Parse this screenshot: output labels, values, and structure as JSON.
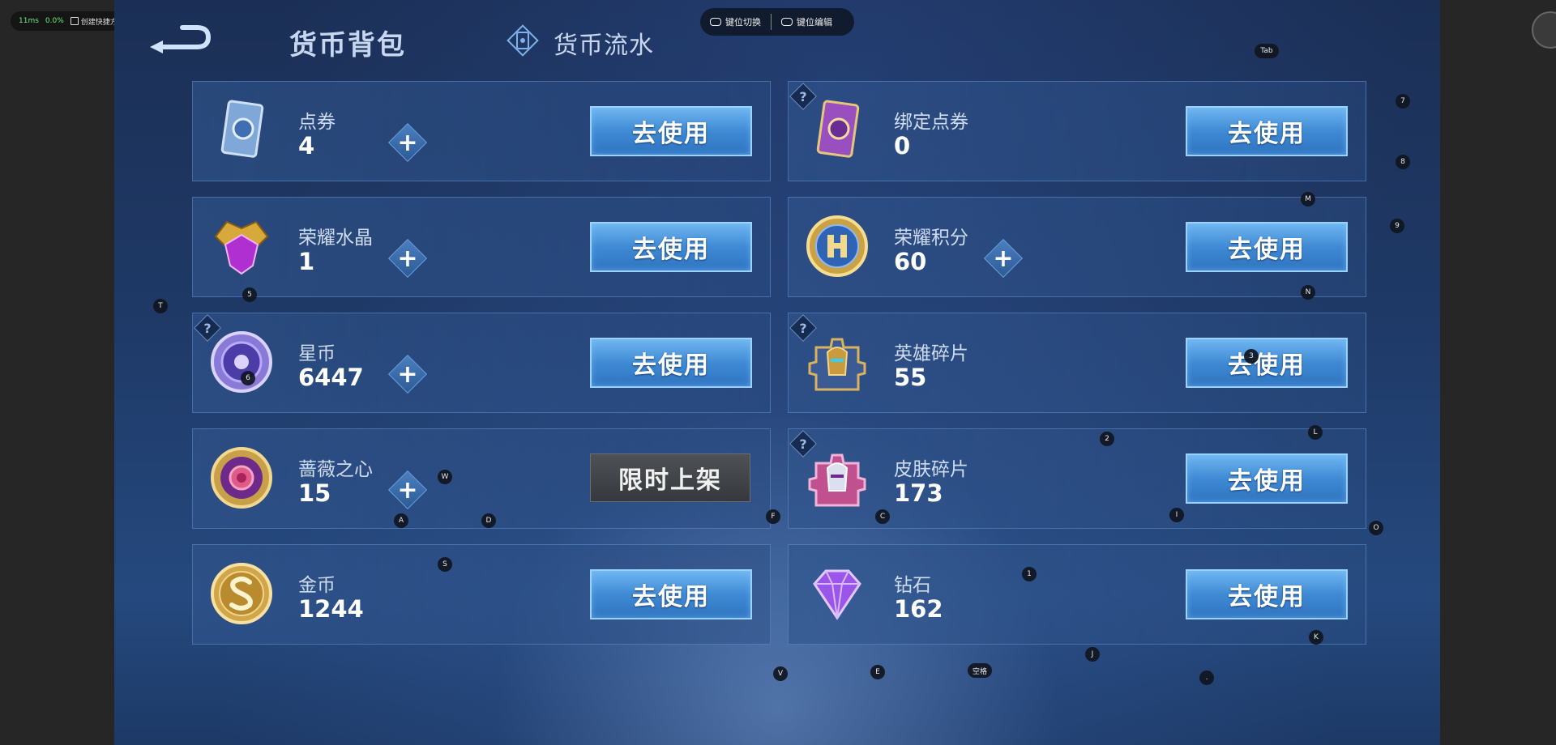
{
  "overlay": {
    "latency": "11ms",
    "percent": "0.0%",
    "shortcut_label": "创建快捷方式"
  },
  "header": {
    "title": "货币背包",
    "flow_tab": "货币流水",
    "back": "back-arrow-icon"
  },
  "keybar": {
    "switch_label": "键位切换",
    "edit_label": "键位编辑"
  },
  "cards": {
    "c0": {
      "label": "点券",
      "amount": "4",
      "button": "去使用"
    },
    "c1": {
      "label": "绑定点券",
      "amount": "0",
      "button": "去使用"
    },
    "c2": {
      "label": "荣耀水晶",
      "amount": "1",
      "button": "去使用"
    },
    "c3": {
      "label": "荣耀积分",
      "amount": "60",
      "button": "去使用"
    },
    "c4": {
      "label": "星币",
      "amount": "6447",
      "button": "去使用"
    },
    "c5": {
      "label": "英雄碎片",
      "amount": "55",
      "button": "去使用"
    },
    "c6": {
      "label": "蔷薇之心",
      "amount": "15",
      "button": "限时上架"
    },
    "c7": {
      "label": "皮肤碎片",
      "amount": "173",
      "button": "去使用"
    },
    "c8": {
      "label": "金币",
      "amount": "1244",
      "button": "去使用"
    },
    "c9": {
      "label": "钻石",
      "amount": "162",
      "button": "去使用"
    }
  },
  "symbols": {
    "plus": "+",
    "question": "?"
  },
  "keys": {
    "tab": "Tab",
    "k7": "7",
    "k8": "8",
    "kM": "M",
    "k9": "9",
    "kN": "N",
    "k5": "5",
    "kT": "T",
    "k3": "3",
    "k6": "6",
    "k2": "2",
    "kL": "L",
    "kW": "W",
    "kA": "A",
    "kD": "D",
    "kF": "F",
    "kC": "C",
    "kI": "I",
    "kO": "O",
    "kS": "S",
    "k1": "1",
    "kK": "K",
    "kJ": "J",
    "kV": "V",
    "kE": "E",
    "space": "空格",
    "dot": "."
  },
  "colors": {
    "use_button": "#3f8ad4",
    "limited_button": "#45494d",
    "card_border": "#6ea0dc"
  }
}
